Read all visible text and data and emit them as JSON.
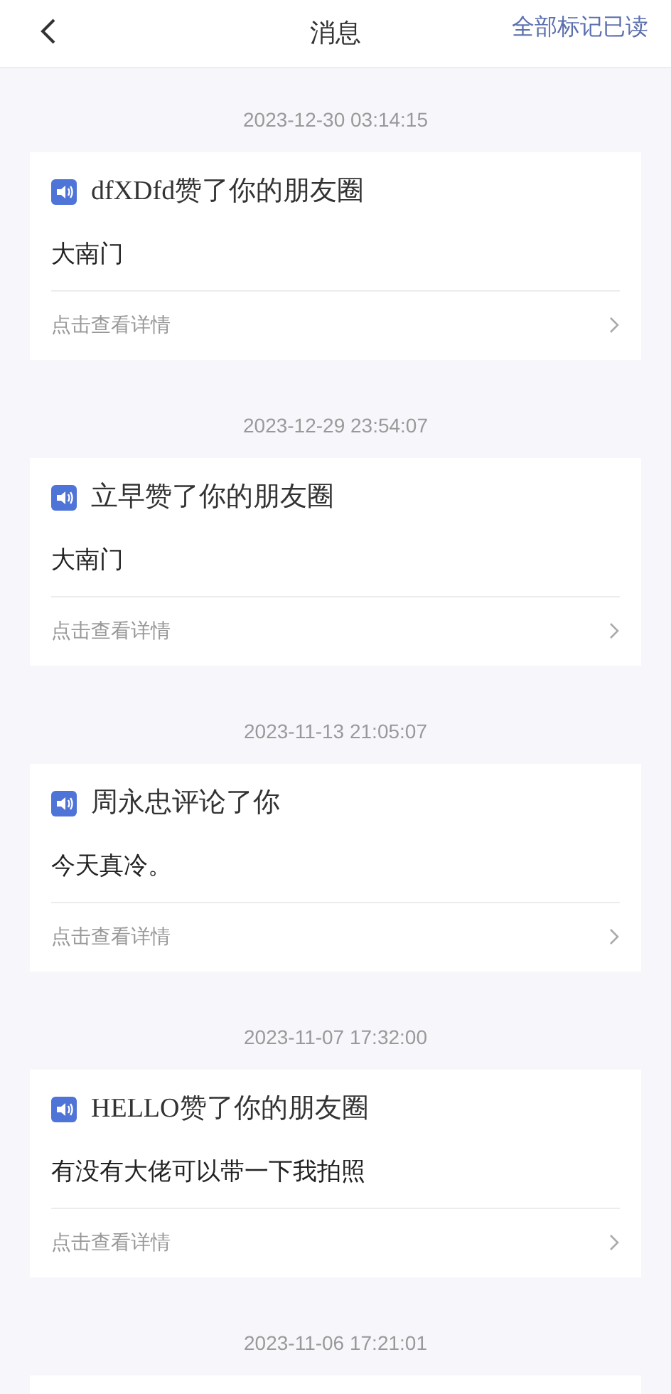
{
  "header": {
    "title": "消息",
    "action": "全部标记已读"
  },
  "messages": [
    {
      "time": "2023-12-30 03:14:15",
      "title": "dfXDfd赞了你的朋友圈",
      "body": "大南门",
      "link": "点击查看详情"
    },
    {
      "time": "2023-12-29 23:54:07",
      "title": "立早赞了你的朋友圈",
      "body": "大南门",
      "link": "点击查看详情"
    },
    {
      "time": "2023-11-13 21:05:07",
      "title": "周永忠评论了你",
      "body": "今天真冷。",
      "link": "点击查看详情"
    },
    {
      "time": "2023-11-07 17:32:00",
      "title": "HELLO赞了你的朋友圈",
      "body": "有没有大佬可以带一下我拍照",
      "link": "点击查看详情"
    },
    {
      "time": "2023-11-06 17:21:01"
    }
  ]
}
